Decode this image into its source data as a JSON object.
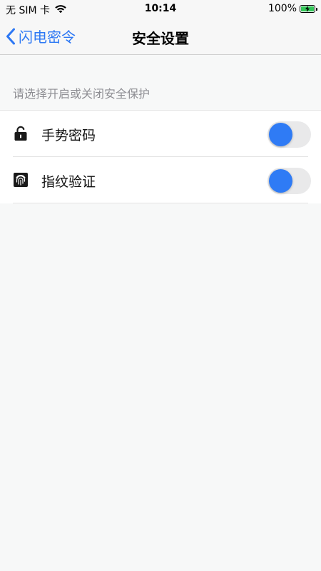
{
  "status_bar": {
    "carrier": "无 SIM 卡",
    "time": "10:14",
    "battery_percent": "100%",
    "battery_level": 1.0,
    "wifi_icon": "wifi-icon",
    "battery_icon": "battery-charging-icon"
  },
  "nav": {
    "back_label": "闪电密令",
    "back_icon": "chevron-left-icon",
    "title": "安全设置"
  },
  "section": {
    "hint": "请选择开启或关闭安全保护"
  },
  "settings": [
    {
      "label": "手势密码",
      "icon": "lock-open-icon",
      "enabled": false
    },
    {
      "label": "指纹验证",
      "icon": "fingerprint-icon",
      "enabled": false
    }
  ],
  "colors": {
    "accent": "#2d78f4",
    "toggle_knob": "#2f7bf5",
    "toggle_track": "#e9e9ea",
    "battery_fill": "#34c759",
    "background": "#f7f8f8"
  }
}
